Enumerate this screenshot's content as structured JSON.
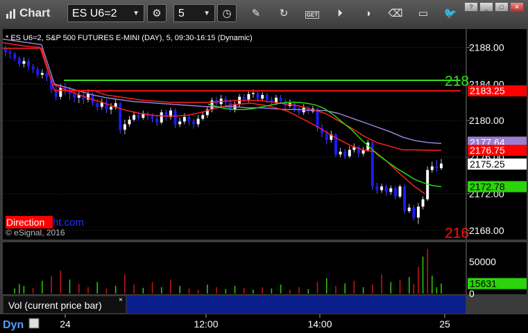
{
  "toolbar": {
    "title": "Chart",
    "symbol": "ES U6=2",
    "interval": "5",
    "buttons": [
      "gear-icon",
      "clock-icon",
      "pencil-icon",
      "refresh-icon",
      "get-icon",
      "play-icon",
      "eraser-icon",
      "comment-icon",
      "twitter-icon"
    ],
    "get_label": "GET"
  },
  "chart_data": {
    "type": "candlestick",
    "title": "* ES U6=2, S&P 500 FUTURES E-MINI (DAY), 5, 09:30-16:15 (Dynamic)",
    "watermark": "© eSignal, 2016",
    "brand_a": "Direction",
    "brand_b": "ht.com",
    "y_ticks": [
      "2188.00",
      "2184.00",
      "2180.00",
      "2176.00",
      "2172.00",
      "2168.00"
    ],
    "ylim": [
      2167,
      2190
    ],
    "x_ticks": [
      "24",
      "12:00",
      "14:00",
      "25"
    ],
    "price_labels": [
      {
        "text": "2183.25",
        "value": 2183.25,
        "bg": "#ff0000",
        "fg": "#ffffff"
      },
      {
        "text": "2177.64",
        "value": 2177.64,
        "bg": "#9a7fd0",
        "fg": "#ffffff"
      },
      {
        "text": "2176.75",
        "value": 2176.75,
        "bg": "#ff0000",
        "fg": "#ffffff"
      },
      {
        "text": "2175.25",
        "value": 2175.25,
        "bg": "#ffffff",
        "fg": "#000000"
      },
      {
        "text": "2172.78",
        "value": 2172.78,
        "bg": "#2bd40a",
        "fg": "#000000"
      }
    ],
    "hlines": [
      {
        "value": 2184.4,
        "color": "#32e01a",
        "label": "218"
      },
      {
        "value": 2183.25,
        "color": "#ff1010",
        "label": ""
      },
      {
        "value": 2167.8,
        "color": "#ff1010",
        "label": "216"
      }
    ],
    "candles": [
      [
        2188.0,
        2187.5,
        2188.2,
        2187.0
      ],
      [
        2187.5,
        2187.3,
        2187.8,
        2186.8
      ],
      [
        2187.3,
        2186.8,
        2187.5,
        2186.5
      ],
      [
        2186.8,
        2186.2,
        2187.0,
        2185.9
      ],
      [
        2186.2,
        2186.5,
        2186.9,
        2185.8
      ],
      [
        2186.5,
        2185.9,
        2186.8,
        2185.5
      ],
      [
        2185.9,
        2185.6,
        2186.2,
        2185.2
      ],
      [
        2185.6,
        2185.0,
        2185.9,
        2184.7
      ],
      [
        2185.0,
        2185.2,
        2185.6,
        2184.6
      ],
      [
        2185.2,
        2184.8,
        2185.4,
        2184.3
      ],
      [
        2184.8,
        2183.4,
        2185.0,
        2183.0
      ],
      [
        2183.4,
        2182.6,
        2183.8,
        2182.2
      ],
      [
        2182.6,
        2183.6,
        2184.0,
        2182.3
      ],
      [
        2183.6,
        2183.2,
        2184.1,
        2182.8
      ],
      [
        2183.2,
        2182.9,
        2183.7,
        2182.3
      ],
      [
        2182.9,
        2182.5,
        2183.3,
        2182.0
      ],
      [
        2182.5,
        2182.8,
        2183.2,
        2181.9
      ],
      [
        2182.8,
        2182.3,
        2183.1,
        2181.8
      ],
      [
        2182.3,
        2182.9,
        2183.4,
        2182.0
      ],
      [
        2182.9,
        2181.9,
        2183.1,
        2181.6
      ],
      [
        2181.9,
        2181.5,
        2182.3,
        2181.1
      ],
      [
        2181.5,
        2182.0,
        2182.4,
        2181.2
      ],
      [
        2182.0,
        2181.2,
        2182.3,
        2180.8
      ],
      [
        2181.2,
        2181.5,
        2181.9,
        2180.7
      ],
      [
        2181.5,
        2181.9,
        2182.3,
        2181.2
      ],
      [
        2181.9,
        2179.0,
        2182.0,
        2178.6
      ],
      [
        2179.0,
        2179.6,
        2180.1,
        2178.5
      ],
      [
        2179.6,
        2180.1,
        2180.5,
        2179.3
      ],
      [
        2180.1,
        2180.6,
        2181.0,
        2179.9
      ],
      [
        2180.6,
        2180.3,
        2180.9,
        2180.0
      ],
      [
        2180.3,
        2180.8,
        2181.1,
        2180.1
      ],
      [
        2180.8,
        2180.5,
        2181.0,
        2180.1
      ],
      [
        2180.5,
        2180.2,
        2180.8,
        2179.8
      ],
      [
        2180.2,
        2179.8,
        2180.6,
        2179.4
      ],
      [
        2179.8,
        2180.9,
        2181.2,
        2179.6
      ],
      [
        2180.9,
        2180.4,
        2181.2,
        2180.0
      ],
      [
        2180.4,
        2181.1,
        2181.4,
        2180.1
      ],
      [
        2181.1,
        2179.6,
        2181.3,
        2179.2
      ],
      [
        2179.6,
        2179.9,
        2180.3,
        2179.3
      ],
      [
        2179.9,
        2180.4,
        2180.8,
        2179.6
      ],
      [
        2180.4,
        2179.9,
        2180.6,
        2179.5
      ],
      [
        2179.9,
        2179.6,
        2180.2,
        2179.1
      ],
      [
        2179.6,
        2180.2,
        2180.6,
        2179.3
      ],
      [
        2180.2,
        2180.6,
        2181.0,
        2180.0
      ],
      [
        2180.6,
        2181.2,
        2181.5,
        2180.3
      ],
      [
        2181.2,
        2182.2,
        2182.5,
        2180.9
      ],
      [
        2182.2,
        2181.8,
        2182.6,
        2181.4
      ],
      [
        2181.8,
        2182.4,
        2182.8,
        2181.5
      ],
      [
        2182.4,
        2182.0,
        2182.7,
        2181.6
      ],
      [
        2182.0,
        2181.2,
        2182.3,
        2180.9
      ],
      [
        2181.2,
        2181.8,
        2182.1,
        2180.9
      ],
      [
        2181.8,
        2182.6,
        2182.9,
        2181.5
      ],
      [
        2182.6,
        2182.3,
        2182.9,
        2182.0
      ],
      [
        2182.3,
        2182.9,
        2183.2,
        2182.0
      ],
      [
        2182.9,
        2183.0,
        2183.4,
        2182.5
      ],
      [
        2183.0,
        2182.4,
        2183.2,
        2182.0
      ],
      [
        2182.4,
        2182.8,
        2183.1,
        2182.1
      ],
      [
        2182.8,
        2182.3,
        2183.0,
        2181.9
      ],
      [
        2182.3,
        2182.0,
        2182.6,
        2181.6
      ],
      [
        2182.0,
        2182.5,
        2182.8,
        2181.7
      ],
      [
        2182.5,
        2182.1,
        2182.8,
        2181.8
      ],
      [
        2182.1,
        2181.6,
        2182.4,
        2181.2
      ],
      [
        2181.6,
        2181.9,
        2182.3,
        2181.4
      ],
      [
        2181.9,
        2181.2,
        2182.1,
        2180.9
      ],
      [
        2181.2,
        2180.9,
        2181.5,
        2180.6
      ],
      [
        2180.9,
        2181.4,
        2181.8,
        2180.6
      ],
      [
        2181.4,
        2181.0,
        2181.6,
        2180.7
      ],
      [
        2181.0,
        2181.3,
        2181.6,
        2180.8
      ],
      [
        2181.3,
        2179.2,
        2181.4,
        2178.8
      ],
      [
        2179.2,
        2178.6,
        2179.6,
        2178.2
      ],
      [
        2178.6,
        2177.9,
        2179.0,
        2177.4
      ],
      [
        2177.9,
        2178.5,
        2178.9,
        2177.6
      ],
      [
        2178.5,
        2176.3,
        2178.6,
        2176.0
      ],
      [
        2176.3,
        2176.6,
        2177.0,
        2176.0
      ],
      [
        2176.6,
        2176.1,
        2176.9,
        2175.8
      ],
      [
        2176.1,
        2176.8,
        2177.2,
        2175.9
      ],
      [
        2176.8,
        2177.1,
        2177.5,
        2176.5
      ],
      [
        2177.1,
        2176.4,
        2177.3,
        2176.0
      ],
      [
        2176.4,
        2176.8,
        2177.1,
        2176.1
      ],
      [
        2176.8,
        2177.6,
        2177.9,
        2176.6
      ],
      [
        2177.6,
        2172.8,
        2177.8,
        2172.4
      ],
      [
        2172.8,
        2172.4,
        2173.2,
        2172.0
      ],
      [
        2172.4,
        2172.8,
        2173.1,
        2172.1
      ],
      [
        2172.8,
        2172.2,
        2173.0,
        2171.8
      ],
      [
        2172.2,
        2172.6,
        2172.9,
        2171.9
      ],
      [
        2172.6,
        2171.7,
        2172.8,
        2171.4
      ],
      [
        2171.7,
        2172.8,
        2173.0,
        2171.5
      ],
      [
        2172.8,
        2170.1,
        2173.0,
        2169.8
      ],
      [
        2170.1,
        2170.5,
        2170.9,
        2169.9
      ],
      [
        2170.5,
        2169.4,
        2170.8,
        2169.1
      ],
      [
        2169.4,
        2170.6,
        2171.0,
        2168.7
      ],
      [
        2170.6,
        2171.4,
        2171.7,
        2170.3
      ],
      [
        2171.4,
        2174.6,
        2175.0,
        2171.2
      ],
      [
        2174.6,
        2175.0,
        2175.5,
        2174.3
      ],
      [
        2175.0,
        2174.8,
        2175.7,
        2174.4
      ],
      [
        2174.8,
        2175.3,
        2175.8,
        2174.6
      ]
    ],
    "purple_line": [
      2188.9,
      2188.7,
      2188.5,
      2188.3,
      2184.0,
      2183.6,
      2183.2,
      2182.8,
      2182.5,
      2182.3,
      2182.1,
      2182.0,
      2181.9,
      2181.8,
      2181.7,
      2181.6,
      2181.5,
      2181.5,
      2181.5,
      2181.4,
      2181.4,
      2181.3,
      2181.2,
      2181.2,
      2181.1,
      2181.1,
      2180.8,
      2180.3,
      2179.8,
      2179.3,
      2178.8,
      2178.2,
      2177.8,
      2177.6,
      2177.5
    ],
    "red_line": [
      2188.5,
      2188.3,
      2188.1,
      2188.0,
      2184.0,
      2183.4,
      2182.9,
      2182.4,
      2182.0,
      2181.5,
      2181.1,
      2180.8,
      2180.6,
      2180.5,
      2180.5,
      2180.6,
      2180.9,
      2181.3,
      2181.6,
      2181.8,
      2181.9,
      2181.7,
      2181.4,
      2181.0,
      2180.3,
      2179.6,
      2178.8,
      2178.0,
      2177.3,
      2176.8,
      2176.6,
      2175.5,
      2174.2,
      2173.0,
      2172.0
    ],
    "red_upper": [
      2187.9,
      2187.9,
      2187.9,
      2187.9,
      2183.3,
      2183.3,
      2183.3,
      2183.3,
      2182.8,
      2182.6,
      2182.4,
      2182.2,
      2182.1,
      2182.0,
      2182.0,
      2182.0,
      2182.0,
      2182.1,
      2182.2,
      2182.2,
      2182.2,
      2182.0,
      2181.8,
      2181.6,
      2181.2,
      2180.8,
      2180.0,
      2179.2,
      2178.3,
      2177.6,
      2177.2,
      2176.8,
      2176.8,
      2176.75,
      2176.75
    ],
    "green_line": [
      2181.8,
      2181.5,
      2181.3,
      2181.2,
      2181.2,
      2181.3,
      2181.5,
      2181.7,
      2181.9,
      2182.0,
      2182.0,
      2181.9,
      2181.7,
      2181.3,
      2180.6,
      2179.8,
      2179.0,
      2178.0,
      2177.1,
      2176.2,
      2175.5,
      2174.8,
      2174.2,
      2173.6,
      2173.2,
      2172.9,
      2172.78
    ],
    "volume": {
      "label": "Vol (current price bar)",
      "y_ticks": [
        "50000",
        "0"
      ],
      "value_label": "15631",
      "max": 75000,
      "bars": [
        [
          2,
          0,
          8000
        ],
        [
          3,
          0,
          15000
        ],
        [
          4,
          0,
          12000
        ],
        [
          6,
          1,
          9000
        ],
        [
          8,
          0,
          20000
        ],
        [
          10,
          1,
          28000
        ],
        [
          12,
          1,
          36000
        ],
        [
          14,
          0,
          22000
        ],
        [
          16,
          1,
          15000
        ],
        [
          18,
          1,
          10000
        ],
        [
          20,
          0,
          18000
        ],
        [
          22,
          1,
          8000
        ],
        [
          24,
          0,
          12000
        ],
        [
          26,
          1,
          30000
        ],
        [
          28,
          1,
          14000
        ],
        [
          30,
          0,
          9000
        ],
        [
          32,
          1,
          18000
        ],
        [
          34,
          0,
          10000
        ],
        [
          36,
          1,
          22000
        ],
        [
          38,
          0,
          12000
        ],
        [
          40,
          1,
          8000
        ],
        [
          42,
          1,
          6000
        ],
        [
          44,
          0,
          14000
        ],
        [
          46,
          1,
          10000
        ],
        [
          48,
          0,
          7000
        ],
        [
          50,
          0,
          12000
        ],
        [
          52,
          1,
          9000
        ],
        [
          54,
          0,
          6000
        ],
        [
          56,
          1,
          10000
        ],
        [
          58,
          0,
          8000
        ],
        [
          60,
          0,
          14000
        ],
        [
          62,
          1,
          6000
        ],
        [
          64,
          1,
          10000
        ],
        [
          66,
          0,
          7000
        ],
        [
          68,
          1,
          18000
        ],
        [
          70,
          0,
          24000
        ],
        [
          72,
          1,
          12000
        ],
        [
          74,
          0,
          16000
        ],
        [
          76,
          1,
          20000
        ],
        [
          78,
          0,
          10000
        ],
        [
          80,
          1,
          14000
        ],
        [
          82,
          1,
          30000
        ],
        [
          84,
          0,
          18000
        ],
        [
          86,
          1,
          22000
        ],
        [
          88,
          0,
          26000
        ],
        [
          89,
          1,
          15000
        ],
        [
          90,
          1,
          42000
        ],
        [
          91,
          0,
          58000
        ],
        [
          92,
          1,
          70000
        ],
        [
          93,
          0,
          28000
        ],
        [
          94,
          0,
          10000
        ],
        [
          95,
          0,
          15631
        ]
      ]
    }
  },
  "bottom": {
    "label": "Dyn"
  }
}
